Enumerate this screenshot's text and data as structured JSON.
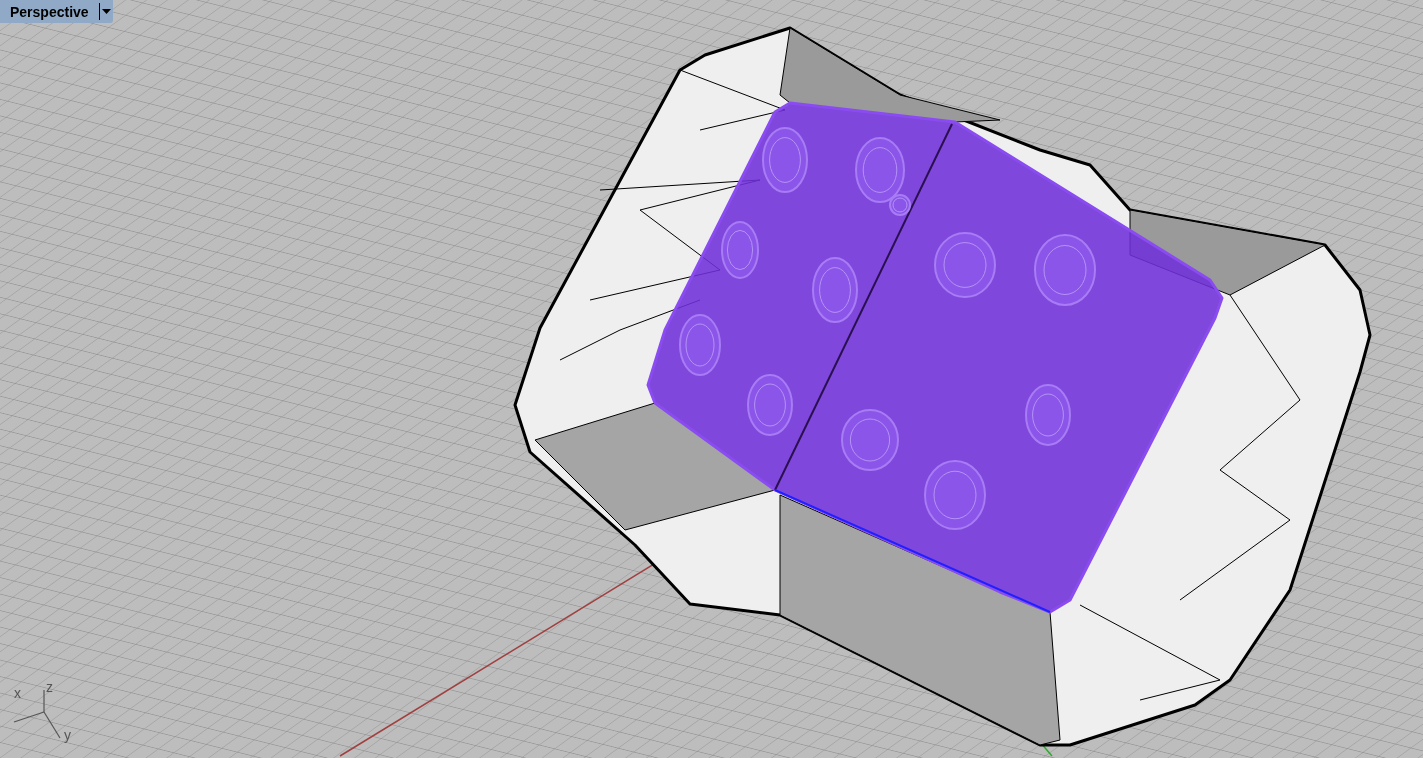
{
  "viewport": {
    "title": "Perspective",
    "axes": [
      {
        "kind": "x",
        "label": "x"
      },
      {
        "kind": "y",
        "label": "y"
      },
      {
        "kind": "z",
        "label": "z"
      }
    ]
  }
}
